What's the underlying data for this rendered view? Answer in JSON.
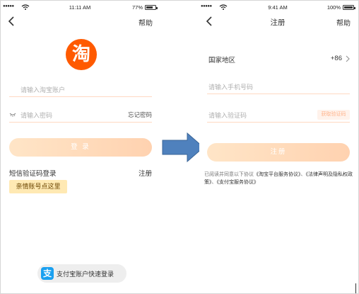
{
  "login_screen": {
    "status_bar": {
      "signal": "●●●●●",
      "time": "11:11 AM",
      "battery": "77%",
      "battery_level": 0.77
    },
    "nav": {
      "help": "帮助"
    },
    "logo_char": "淘",
    "account_placeholder": "请输入淘宝账户",
    "password_placeholder": "请输入密码",
    "forgot_password": "忘记密码",
    "login_button": "登 录",
    "sms_login": "短信验证码登录",
    "register": "注册",
    "family_account": "亲情账号点这里",
    "alipay_icon_char": "支",
    "alipay_quick_login": "支付宝账户快速登录"
  },
  "register_screen": {
    "status_bar": {
      "signal": "●●●●●",
      "time": "9:41 AM",
      "battery": "100%",
      "battery_level": 1.0
    },
    "nav": {
      "title": "注册",
      "help": "帮助"
    },
    "region_label": "国家地区",
    "region_code": "+86",
    "phone_placeholder": "请输入手机号码",
    "code_placeholder": "请输入验证码",
    "get_code": "获取验证码",
    "register_button": "注册",
    "agreement_prefix": "已阅读并同意以下协议",
    "agreement_link_1": "《淘宝平台服务协议》",
    "agreement_sep_1": "、",
    "agreement_link_2": "《法律声明及隐私权政策》",
    "agreement_sep_2": "、",
    "agreement_link_3": "《支付宝服务协议》"
  },
  "colors": {
    "taobao_orange": "#ff5a00",
    "arrow_blue": "#4f81bd",
    "button_gradient_start": "#ffe5c7",
    "button_gradient_end": "#ffd2b0",
    "alipay_blue": "#1aa0f0"
  },
  "icons": [
    "back-icon",
    "wifi-icon",
    "battery-icon",
    "eye-closed-icon",
    "chevron-right-icon",
    "alipay-icon",
    "arrow-right-icon"
  ]
}
